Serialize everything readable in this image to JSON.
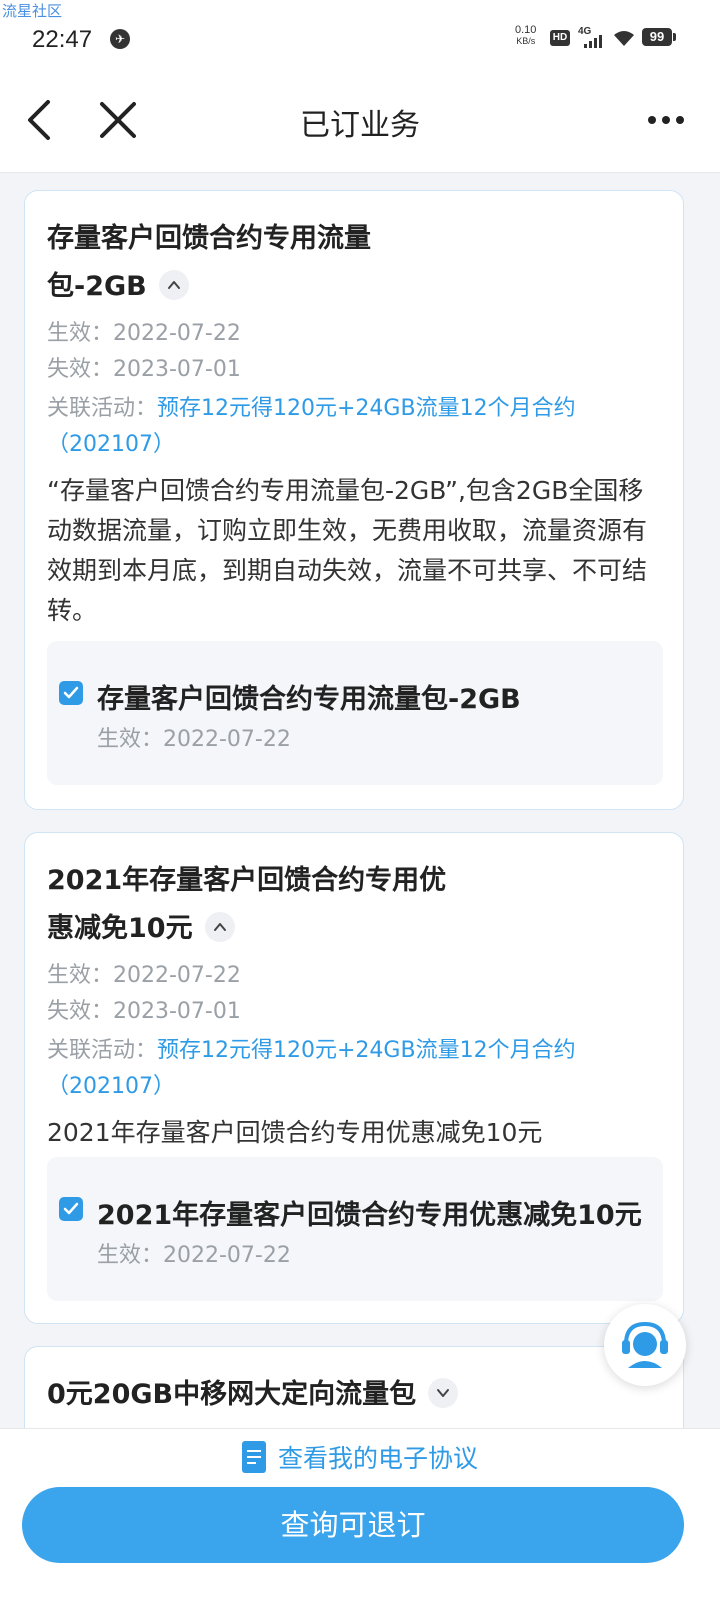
{
  "watermark": "流星社区",
  "status": {
    "time": "22:47",
    "net_speed_value": "0.10",
    "net_speed_unit": "KB/s",
    "hd": "HD",
    "network": "4G",
    "battery": "99"
  },
  "nav": {
    "title": "已订业务"
  },
  "cards": [
    {
      "title_line1": "存量客户回馈合约专用流量",
      "title_line2": "包-2GB",
      "effective": "生效：2022-07-22",
      "expire": "失效：2023-07-01",
      "related_label": "关联活动：",
      "related_link": "预存12元得120元+24GB流量12个月合约（202107）",
      "desc": "“存量客户回馈合约专用流量包-2GB”,包含2GB全国移动数据流量，订购立即生效，无费用收取，流量资源有效期到本月底，到期自动失效，流量不可共享、不可结转。",
      "sub_title": "存量客户回馈合约专用流量包-2GB",
      "sub_date": "生效：2022-07-22"
    },
    {
      "title_line1": "2021年存量客户回馈合约专用优",
      "title_line2": "惠减免10元",
      "effective": "生效：2022-07-22",
      "expire": "失效：2023-07-01",
      "related_label": "关联活动：",
      "related_link": "预存12元得120元+24GB流量12个月合约（202107）",
      "desc": "2021年存量客户回馈合约专用优惠减免10元",
      "sub_title": "2021年存量客户回馈合约专用优惠减免10元",
      "sub_date": "生效：2022-07-22"
    },
    {
      "title_line1": "0元20GB中移网大定向流量包"
    }
  ],
  "bottom": {
    "agreement_link": "查看我的电子协议",
    "button_label": "查询可退订"
  }
}
